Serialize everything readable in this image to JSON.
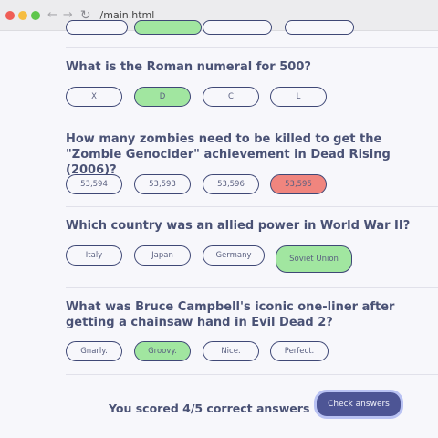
{
  "browser": {
    "url": "/main.html"
  },
  "questions": [
    {
      "text": "What is the Roman numeral for 500?",
      "options": [
        {
          "label": "X",
          "state": "default"
        },
        {
          "label": "D",
          "state": "correct"
        },
        {
          "label": "C",
          "state": "default"
        },
        {
          "label": "L",
          "state": "default"
        }
      ]
    },
    {
      "text": "How many zombies need to be killed to get the \"Zombie Genocider\" achievement in Dead Rising (2006)?",
      "options": [
        {
          "label": "53,594",
          "state": "default"
        },
        {
          "label": "53,593",
          "state": "default"
        },
        {
          "label": "53,596",
          "state": "default"
        },
        {
          "label": "53,595",
          "state": "wrong"
        }
      ]
    },
    {
      "text": "Which country was an allied power in World War II?",
      "options": [
        {
          "label": "Italy",
          "state": "default"
        },
        {
          "label": "Japan",
          "state": "default"
        },
        {
          "label": "Germany",
          "state": "default"
        },
        {
          "label": "Soviet Union",
          "state": "correct"
        }
      ]
    },
    {
      "text": "What was Bruce Campbell's iconic one-liner after getting a chainsaw hand in Evil Dead 2?",
      "options": [
        {
          "label": "Gnarly.",
          "state": "default"
        },
        {
          "label": "Groovy.",
          "state": "correct"
        },
        {
          "label": "Nice.",
          "state": "default"
        },
        {
          "label": "Perfect.",
          "state": "default"
        }
      ]
    }
  ],
  "footer": {
    "score_text": "You scored 4/5 correct answers",
    "check_button_label": "Check answers"
  },
  "colors": {
    "correct": "#a1e6a0",
    "wrong": "#f0857e",
    "primary": "#4d5595",
    "text": "#4a5275"
  }
}
